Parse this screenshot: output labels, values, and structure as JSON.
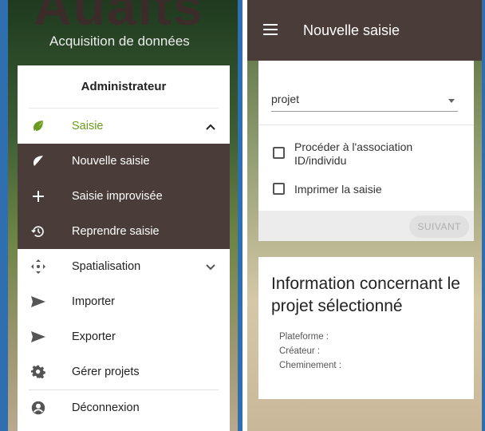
{
  "left": {
    "logo_text": "Auaits",
    "logo_subtitle": "Acquisition de données",
    "drawer_title": "Administrateur",
    "items": [
      {
        "label": "Saisie",
        "icon": "leaf-icon",
        "expanded": true
      },
      {
        "label": "Nouvelle saisie",
        "icon": "leaf-icon"
      },
      {
        "label": "Saisie improvisée",
        "icon": "plus-icon"
      },
      {
        "label": "Reprendre saisie",
        "icon": "history-icon"
      },
      {
        "label": "Spatialisation",
        "icon": "move-arrows-icon",
        "expanded": false
      },
      {
        "label": "Importer",
        "icon": "send-icon"
      },
      {
        "label": "Exporter",
        "icon": "send-icon"
      },
      {
        "label": "Gérer projets",
        "icon": "gear-icon"
      },
      {
        "label": "Déconnexion",
        "icon": "account-icon"
      }
    ]
  },
  "right": {
    "appbar_title": "Nouvelle saisie",
    "select_value": "projet",
    "checkbox_association": "Procéder à l'association ID/individu",
    "checkbox_print": "Imprimer la saisie",
    "next_button": "SUIVANT",
    "info_title": "Information concernant le projet sélectionné",
    "info_platform": "Plateforme :",
    "info_creator": "Créateur :",
    "info_path": "Cheminement :"
  },
  "colors": {
    "appbar": "#4a3c39",
    "accent_green": "#6a9a1e",
    "frame_blue": "#2f6fb0"
  }
}
